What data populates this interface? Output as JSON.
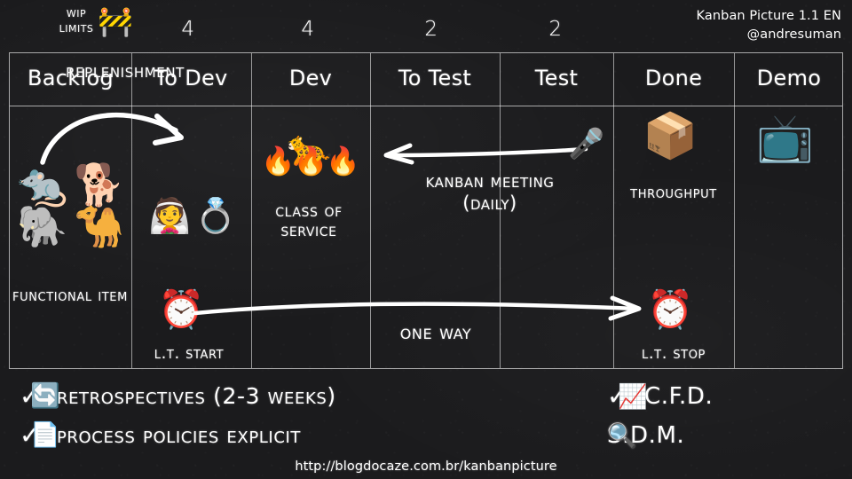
{
  "brand": {
    "title": "Kanban Picture 1.1 EN",
    "handle": "@andresuman"
  },
  "wip": {
    "line1": "WIP",
    "line2": "Limits",
    "barrier_icon": "🚧",
    "limits": [
      "",
      "4",
      "4",
      "2",
      "2",
      "",
      ""
    ]
  },
  "board": {
    "columns": [
      {
        "title": "Backlog"
      },
      {
        "title": "To Dev"
      },
      {
        "title": "Dev"
      },
      {
        "title": "To Test"
      },
      {
        "title": "Test"
      },
      {
        "title": "Done"
      },
      {
        "title": "Demo"
      }
    ]
  },
  "backlog": {
    "replenishment_label": "Replenishment",
    "animals": [
      "🐀",
      "🐕",
      "🐘",
      "🐪"
    ],
    "functional_item_label": "Functional Item"
  },
  "todev": {
    "icons": [
      "👰",
      "💍"
    ],
    "lt_start_icon": "⏰",
    "lt_start_label": "L.T. Start"
  },
  "dev": {
    "leopard_icon": "🐆",
    "fire_icons": "🔥🔥🔥",
    "class_of_service_label": "Class of Service"
  },
  "meeting": {
    "label_line1": "Kanban Meeting",
    "label_line2": "(Daily)",
    "mic_icon": "🎤"
  },
  "oneway": {
    "label": "One Way"
  },
  "done": {
    "package_icon": "📦",
    "throughput_label": "Throughput",
    "lt_stop_icon": "⏰",
    "lt_stop_label": "L.T. Stop"
  },
  "demo": {
    "tv_icon": "📺"
  },
  "footer": {
    "check_mark": "✓",
    "items": [
      {
        "text": "Retrospectives (2-3 Weeks)",
        "icon": "🔄"
      },
      {
        "text": "Process Policies Explicit",
        "icon": "📄"
      },
      {
        "text": "C.F.D.",
        "icon": "📈"
      },
      {
        "text": "S.D.M.",
        "icon": "🔍"
      }
    ],
    "url": "http://blogdocaze.com.br/kanbanpicture"
  },
  "colors": {
    "background": "#1b1b1d",
    "chalk": "#ffffff",
    "grid": "rgba(255,255,255,0.6)"
  }
}
